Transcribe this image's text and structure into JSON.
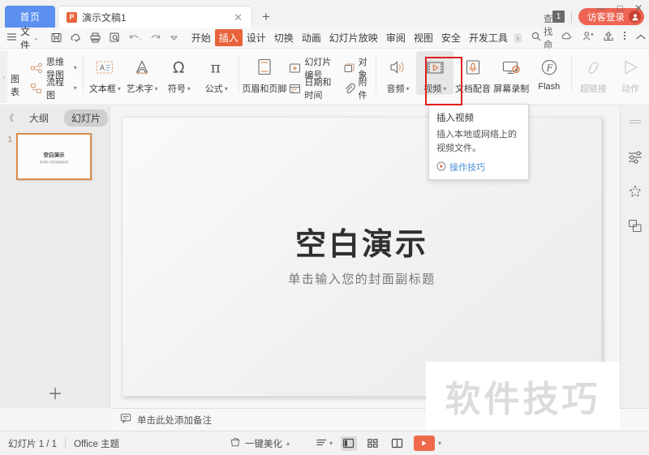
{
  "titlebar": {
    "home_label": "首页",
    "doc_tab": {
      "icon": "powerpoint-icon",
      "icon_letter": "P",
      "title": "演示文稿1",
      "close": "✕"
    },
    "new_tab": "+",
    "badge_count": "1",
    "login_label": "访客登录",
    "window_controls": {
      "minimize": "—",
      "maximize": "□",
      "close": "✕"
    }
  },
  "menubar": {
    "menu_icon": "hamburger-icon",
    "file_label": "文件",
    "file_caret": "⌄",
    "quick_access": [
      "save-icon",
      "cloud-sync-icon",
      "print-icon",
      "print-preview-icon",
      "undo-icon",
      "redo-icon",
      "customize-icon"
    ],
    "tabs": [
      {
        "label": "开始",
        "active": false
      },
      {
        "label": "插入",
        "active": true
      },
      {
        "label": "设计",
        "active": false
      },
      {
        "label": "切换",
        "active": false
      },
      {
        "label": "动画",
        "active": false
      },
      {
        "label": "幻灯片放映",
        "active": false
      },
      {
        "label": "审阅",
        "active": false
      },
      {
        "label": "视图",
        "active": false
      },
      {
        "label": "安全",
        "active": false
      },
      {
        "label": "开发工具",
        "active": false
      }
    ],
    "more_tabs": "›",
    "search_placeholder": "查找命令...",
    "right_icons": [
      "cloud-icon",
      "share-user-icon",
      "share-icon",
      "more-icon",
      "collapse-ribbon-icon"
    ]
  },
  "ribbon": {
    "collapse_arrow": "‹",
    "chart_label": "图表",
    "items": [
      {
        "name": "mindmap",
        "label": "思维导图",
        "caret": "▾",
        "icon": "mindmap-icon"
      },
      {
        "name": "flowchart",
        "label": "流程图",
        "caret": "▾",
        "icon": "flowchart-icon"
      },
      {
        "name": "textbox",
        "label": "文本框",
        "caret": "▾",
        "icon": "textbox-icon"
      },
      {
        "name": "wordart",
        "label": "艺术字",
        "caret": "▾",
        "icon": "wordart-icon"
      },
      {
        "name": "symbol",
        "label": "符号",
        "caret": "▾",
        "icon": "omega-icon"
      },
      {
        "name": "formula",
        "label": "公式",
        "caret": "▾",
        "icon": "pi-icon"
      },
      {
        "name": "header-footer",
        "label": "页眉和页脚",
        "icon": "header-footer-icon"
      },
      {
        "name": "slide-number",
        "label": "幻灯片编号",
        "icon": "slide-number-icon"
      },
      {
        "name": "date-time",
        "label": "日期和时间",
        "icon": "calendar-icon"
      },
      {
        "name": "object",
        "label": "对象",
        "icon": "object-icon"
      },
      {
        "name": "attachment",
        "label": "附件",
        "icon": "paperclip-icon"
      },
      {
        "name": "audio",
        "label": "音频",
        "caret": "▾",
        "icon": "speaker-icon"
      },
      {
        "name": "video",
        "label": "视频",
        "caret": "▾",
        "icon": "video-icon",
        "selected": true
      },
      {
        "name": "doc-dubbing",
        "label": "文档配音",
        "icon": "microphone-icon"
      },
      {
        "name": "screen-record",
        "label": "屏幕录制",
        "icon": "screen-record-icon"
      },
      {
        "name": "flash",
        "label": "Flash",
        "icon": "flash-icon"
      },
      {
        "name": "hyperlink",
        "label": "超链接",
        "icon": "link-icon",
        "disabled": true
      },
      {
        "name": "action",
        "label": "动作",
        "icon": "action-icon",
        "disabled": true
      }
    ]
  },
  "tooltip": {
    "title": "插入视频",
    "body": "插入本地或网络上的视频文件。",
    "link": "操作技巧",
    "link_icon": "play-circle-icon"
  },
  "left_panel": {
    "collapse": "《",
    "tabs": [
      {
        "label": "大纲",
        "active": false
      },
      {
        "label": "幻灯片",
        "active": true
      }
    ],
    "slides": [
      {
        "number": "1",
        "title": "空白演示",
        "subtitle": "单击输入您的封面副标题"
      }
    ],
    "add_slide": "＋"
  },
  "slide": {
    "title": "空白演示",
    "subtitle": "单击输入您的封面副标题"
  },
  "watermark": {
    "text": "软件技巧"
  },
  "right_rail": {
    "icons": [
      "properties-icon",
      "star-effects-icon",
      "shape-duplicate-icon"
    ]
  },
  "notes": {
    "icon": "notes-icon",
    "placeholder": "单击此处添加备注"
  },
  "statusbar": {
    "slide_count": "幻灯片 1 / 1",
    "theme": "Office 主题",
    "beautify_icon": "beautify-icon",
    "beautify_label": "一键美化",
    "beautify_caret": "▴",
    "list_icon": "list-view-icon",
    "list_caret": "▾",
    "views": [
      {
        "name": "normal-view",
        "active": true
      },
      {
        "name": "slide-sorter-view",
        "active": false
      },
      {
        "name": "reading-view",
        "active": false
      }
    ],
    "play_icon": "play-icon",
    "play_caret": "▾"
  },
  "colors": {
    "accent_orange": "#e8633a",
    "login_red": "#ee6352",
    "home_blue": "#5b8ff0",
    "annotation_red": "#e11f1f",
    "thumb_border": "#d98c4a"
  }
}
